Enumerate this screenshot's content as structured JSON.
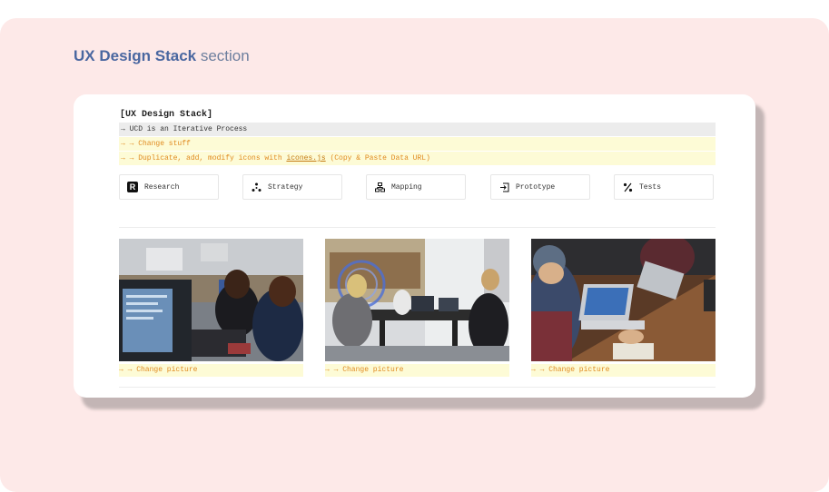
{
  "heading": {
    "bold": "UX Design Stack",
    "rest": " section"
  },
  "doc": {
    "title": "[UX Design Stack]",
    "line1": "→ UCD is an Iterative Process",
    "line2": "→ → Change stuff",
    "line3_pre": "→ → Duplicate, add, modify icons with ",
    "line3_link": "icones.js",
    "line3_post": " (Copy & Paste Data URL)"
  },
  "stack": [
    {
      "label": "Research",
      "icon": "research-icon"
    },
    {
      "label": "Strategy",
      "icon": "strategy-icon"
    },
    {
      "label": "Mapping",
      "icon": "mapping-icon"
    },
    {
      "label": "Prototype",
      "icon": "prototype-icon"
    },
    {
      "label": "Tests",
      "icon": "tests-icon"
    }
  ],
  "pictures": [
    {
      "caption": "→ → Change picture"
    },
    {
      "caption": "→ → Change picture"
    },
    {
      "caption": "→ → Change picture"
    }
  ],
  "colors": {
    "frame": "#fde9e8",
    "highlight": "#fdfbd6",
    "accent": "#e08a1f",
    "heading": "#4a67a0"
  }
}
